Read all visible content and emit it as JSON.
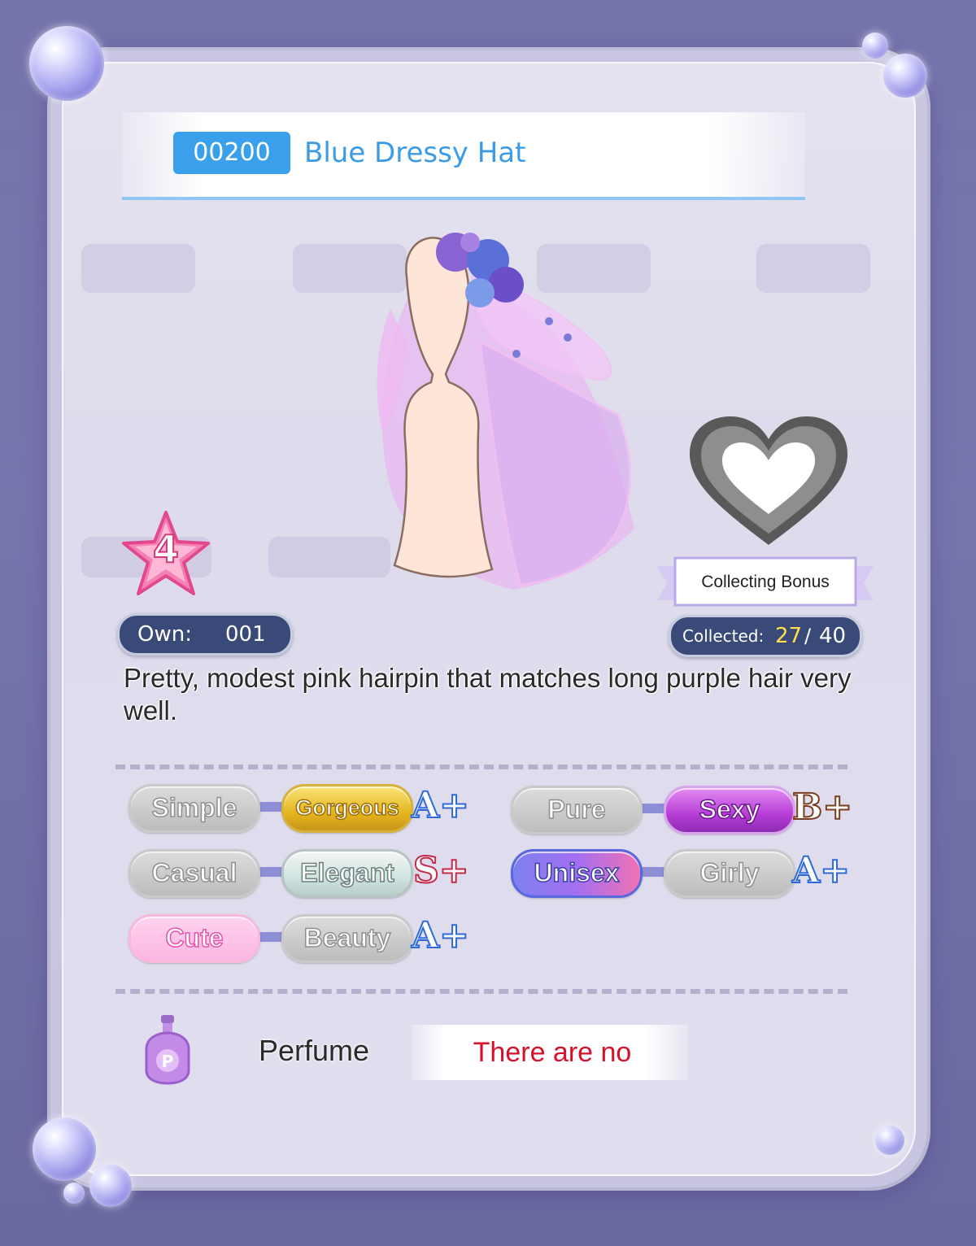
{
  "item": {
    "id": "00200",
    "name": "Blue Dressy Hat",
    "rarity": "4",
    "description": "Pretty, modest pink hairpin that matches long purple hair very well."
  },
  "own": {
    "label": "Own:",
    "value": "001"
  },
  "collecting_bonus": {
    "label": "Collecting Bonus",
    "collected_label": "Collected:",
    "collected": "27",
    "separator": "/",
    "total": "40"
  },
  "styles": [
    {
      "left": "Simple",
      "right": "Gorgeous",
      "grade": "A+",
      "selected": "Gorgeous"
    },
    {
      "left": "Pure",
      "right": "Sexy",
      "grade": "B+",
      "selected": "Sexy"
    },
    {
      "left": "Casual",
      "right": "Elegant",
      "grade": "S+",
      "selected": "Elegant"
    },
    {
      "left": "Unisex",
      "right": "Girly",
      "grade": "A+",
      "selected": "Unisex"
    },
    {
      "left": "Cute",
      "right": "Beauty",
      "grade": "A+",
      "selected": "Cute"
    }
  ],
  "perfume": {
    "icon_letter": "P",
    "label": "Perfume",
    "value": "There are no"
  },
  "icons": [
    "heart-icon",
    "star-rarity-icon",
    "perfume-bottle-icon",
    "bubble-decoration"
  ]
}
